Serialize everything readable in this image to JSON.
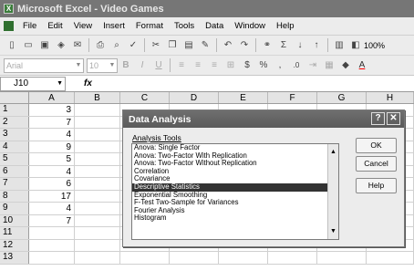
{
  "window": {
    "title": "Microsoft Excel - Video Games"
  },
  "menu": [
    "File",
    "Edit",
    "View",
    "Insert",
    "Format",
    "Tools",
    "Data",
    "Window",
    "Help"
  ],
  "toolbar": {
    "zoom": "100%"
  },
  "format_bar": {
    "font": "Arial",
    "size": "10"
  },
  "formula_bar": {
    "name_box": "J10",
    "fx": "fx"
  },
  "sheet": {
    "columns": [
      "A",
      "B",
      "C",
      "D",
      "E",
      "F",
      "G",
      "H"
    ],
    "rows": [
      "1",
      "2",
      "3",
      "4",
      "5",
      "6",
      "7",
      "8",
      "9",
      "10",
      "11",
      "12",
      "13"
    ],
    "col_a_values": [
      "3",
      "7",
      "4",
      "9",
      "5",
      "4",
      "6",
      "17",
      "4",
      "7",
      "",
      "",
      ""
    ]
  },
  "dialog": {
    "title": "Data Analysis",
    "tools_label": "Analysis Tools",
    "tools": [
      "Anova: Single Factor",
      "Anova: Two-Factor With Replication",
      "Anova: Two-Factor Without Replication",
      "Correlation",
      "Covariance",
      "Descriptive Statistics",
      "Exponential Smoothing",
      "F-Test Two-Sample for Variances",
      "Fourier Analysis",
      "Histogram"
    ],
    "selected_index": 5,
    "ok_label": "OK",
    "cancel_label": "Cancel",
    "help_label": "Help"
  }
}
